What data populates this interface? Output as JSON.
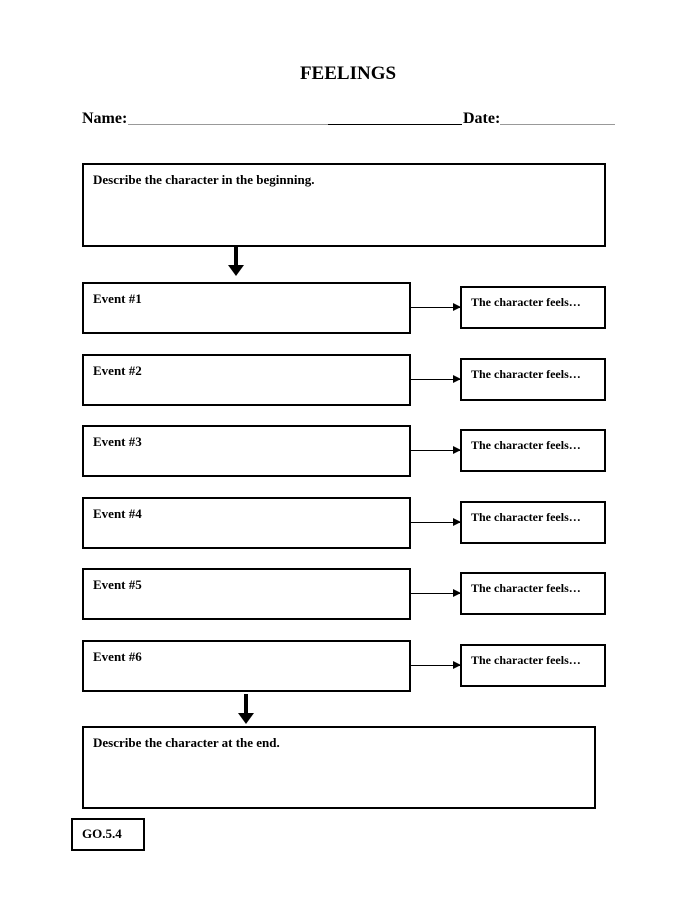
{
  "title": "FEELINGS",
  "header": {
    "name_label": "Name:",
    "date_label": "Date:"
  },
  "beginning_box": {
    "label": "Describe the character in the beginning."
  },
  "events": [
    {
      "label": "Event #1",
      "feels_label": "The character feels…"
    },
    {
      "label": "Event #2",
      "feels_label": "The character feels…"
    },
    {
      "label": "Event #3",
      "feels_label": "The character feels…"
    },
    {
      "label": "Event #4",
      "feels_label": "The character feels…"
    },
    {
      "label": "Event #5",
      "feels_label": "The character feels…"
    },
    {
      "label": "Event #6",
      "feels_label": "The character feels…"
    }
  ],
  "end_box": {
    "label": "Describe the character at the end."
  },
  "footer": {
    "code": "GO.5.4"
  }
}
